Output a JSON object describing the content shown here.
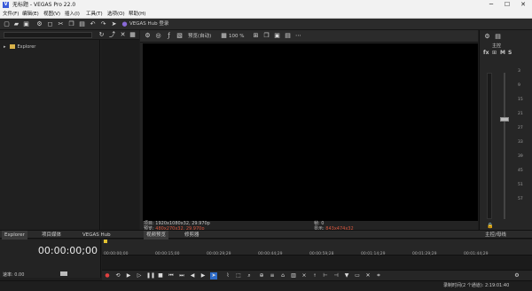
{
  "window": {
    "title": "无标题 - VEGAS Pro 22.0",
    "app_icon": "V"
  },
  "menu": [
    "文件(F)",
    "编辑(E)",
    "视图(V)",
    "插入(I)",
    "工具(T)",
    "选项(O)",
    "帮助(H)"
  ],
  "explorer": {
    "tree_item": "Explorer"
  },
  "hub": {
    "label": "VEGAS Hub 登录"
  },
  "preview": {
    "quality": "预览(自动)",
    "zoom": "100 %"
  },
  "video_info": {
    "project_label": "项目:",
    "project_value": "1920x1080x32, 29.970p",
    "preview_label": "预览:",
    "preview_value": "480x270x32, 29.970p",
    "frame_label": "帧:",
    "frame_value": "0",
    "display_label": "显示:",
    "display_value": "843x474x32"
  },
  "mixer": {
    "label": "主控",
    "fx": "fx",
    "mute": "M",
    "solo": "S",
    "bus_label": "主控/母线",
    "db_ticks": [
      "3",
      "9",
      "15",
      "21",
      "27",
      "33",
      "39",
      "45",
      "51",
      "57"
    ]
  },
  "tabs": [
    "Explorer",
    "项目媒体",
    "VEGAS Hub",
    "视频预览",
    "修剪器"
  ],
  "timeline": {
    "timecode": "00:00:00;00",
    "rate_label": "速率: 0.00",
    "ruler": [
      "00:00:00;00",
      "00:00:15;00",
      "00:00:29;29",
      "00:00:44;29",
      "00:00:59;28",
      "00:01:14;29",
      "00:01:29;29",
      "00:01:44;29"
    ]
  },
  "status": {
    "text": "录制时间(2 个通道): 2:19:01:40"
  }
}
